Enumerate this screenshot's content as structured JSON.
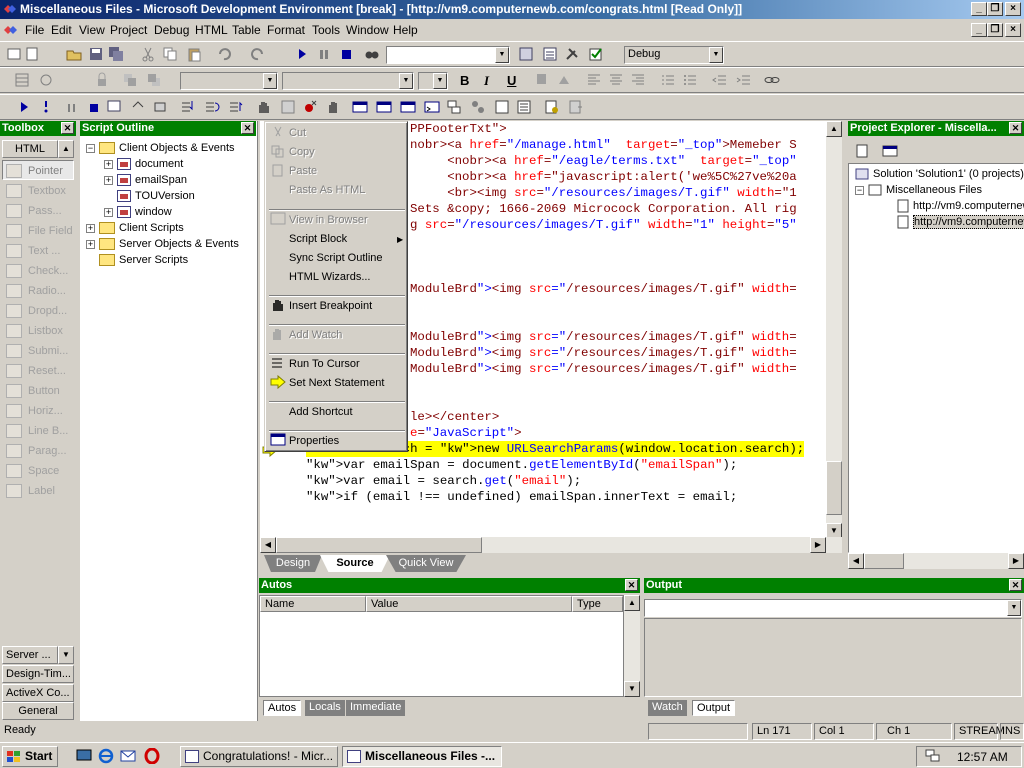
{
  "window": {
    "title": "Miscellaneous Files - Microsoft Development Environment [break] - [http://vm9.computernewb.com/congrats.html [Read Only]]"
  },
  "menu": [
    "File",
    "Edit",
    "View",
    "Project",
    "Debug",
    "HTML",
    "Table",
    "Format",
    "Tools",
    "Window",
    "Help"
  ],
  "toolbar": {
    "config_combo": "Debug"
  },
  "toolbox": {
    "title": "Toolbox",
    "tab": "HTML",
    "items": [
      "Pointer",
      "Textbox",
      "Pass...",
      "File Field",
      "Text ...",
      "Check...",
      "Radio...",
      "Dropd...",
      "Listbox",
      "Submi...",
      "Reset...",
      "Button",
      "Horiz...",
      "Line B...",
      "Parag...",
      "Space",
      "Label"
    ],
    "bottom_tabs": [
      "Server ...",
      "Design-Tim...",
      "ActiveX Co...",
      "General"
    ]
  },
  "outline": {
    "title": "Script Outline",
    "nodes": [
      {
        "label": "Client Objects & Events",
        "kind": "folder",
        "expander": "-"
      },
      {
        "label": "document",
        "kind": "obj",
        "expander": "+"
      },
      {
        "label": "emailSpan",
        "kind": "obj",
        "expander": "+"
      },
      {
        "label": "TOUVersion",
        "kind": "obj",
        "expander": ""
      },
      {
        "label": "window",
        "kind": "obj",
        "expander": "+"
      },
      {
        "label": "Client Scripts",
        "kind": "folder",
        "expander": "+"
      },
      {
        "label": "Server Objects & Events",
        "kind": "folder",
        "expander": "+"
      },
      {
        "label": "Server Scripts",
        "kind": "folder",
        "expander": ""
      }
    ]
  },
  "context_menu": {
    "items": [
      {
        "label": "Cut",
        "disabled": true
      },
      {
        "label": "Copy",
        "disabled": true
      },
      {
        "label": "Paste",
        "disabled": true
      },
      {
        "label": "Paste As HTML",
        "disabled": true
      },
      {
        "label": "View in Browser",
        "disabled": true
      },
      {
        "label": "Script Block",
        "disabled": false,
        "submenu": true
      },
      {
        "label": "Sync Script Outline",
        "disabled": false
      },
      {
        "label": "HTML Wizards...",
        "disabled": false
      },
      {
        "label": "Insert Breakpoint",
        "disabled": false
      },
      {
        "label": "Add Watch",
        "disabled": true
      },
      {
        "label": "Run To Cursor",
        "disabled": false
      },
      {
        "label": "Set Next Statement",
        "disabled": false
      },
      {
        "label": "Add Shortcut",
        "disabled": false
      },
      {
        "label": "Properties",
        "disabled": false
      }
    ]
  },
  "code": {
    "lines": [
      "PPFooterTxt\">",
      "nobr><a href=\"/manage.html\"  target=\"_top\">Memeber S",
      "     <nobr><a href=\"/eagle/terms.txt\"  target=\"_top\"",
      "     <nobr><a href=\"javascript:alert('we%5C%27ve%20a",
      "     <br><img src=\"/resources/images/T.gif\" width=\"1",
      "Sets &copy; 1666-2069 Microcock Corporation. All rig",
      "g src=\"/resources/images/T.gif\" width=\"1\" height=\"5\"",
      "ModuleBrd\"><img src=\"/resources/images/T.gif\" width=",
      "ModuleBrd\"><img src=\"/resources/images/T.gif\" width=",
      "ModuleBrd\"><img src=\"/resources/images/T.gif\" width=",
      "ModuleBrd\"><img src=\"/resources/images/T.gif\" width=",
      "le></center>",
      "e=\"JavaScript\">",
      "var search = new URLSearchParams(window.location.search);",
      "var emailSpan = document.getElementById(\"emailSpan\");",
      "var email = search.get(\"email\");",
      "if (email !== undefined) emailSpan.innerText = email;"
    ]
  },
  "editor_tabs": [
    "Design",
    "Source",
    "Quick View"
  ],
  "project": {
    "title": "Project Explorer - Miscella...",
    "solution": "Solution 'Solution1' (0 projects)",
    "folder": "Miscellaneous Files",
    "files": [
      "http://vm9.computernewb",
      "http://vm9.computernewb"
    ]
  },
  "autos": {
    "title": "Autos",
    "columns": [
      "Name",
      "Value",
      "Type"
    ],
    "tabs": [
      "Autos",
      "Locals",
      "Immediate"
    ]
  },
  "output": {
    "title": "Output",
    "tabs": [
      "Watch",
      "Output"
    ]
  },
  "status": {
    "text": "Ready",
    "ln": "Ln 171",
    "col": "Col 1",
    "ch": "Ch 1",
    "mode1": "STREAM",
    "mode2": "INS"
  },
  "taskbar": {
    "start": "Start",
    "tasks": [
      "Congratulations! - Micr...",
      "Miscellaneous Files -..."
    ],
    "time": "12:57 AM"
  }
}
